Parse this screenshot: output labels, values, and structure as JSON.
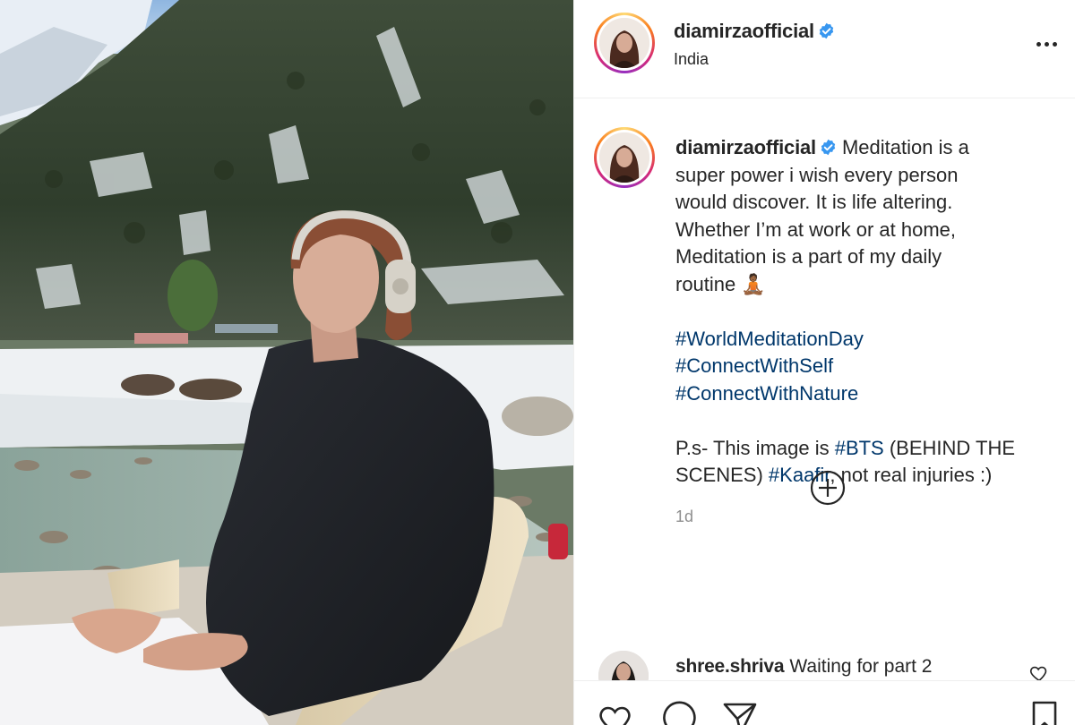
{
  "post": {
    "username": "diamirzaofficial",
    "verified": true,
    "location": "India",
    "more_icon": "more-horizontal-icon"
  },
  "caption": {
    "username": "diamirzaofficial",
    "text_lines": [
      "Meditation is a",
      "super power i wish every person",
      "would discover. It is life altering.",
      "Whether I’m at work or at home,",
      "Meditation is a part of my daily",
      "routine 🧘🏾"
    ],
    "hashtags": [
      "#WorldMeditationDay",
      "#ConnectWithSelf",
      "#ConnectWithNature"
    ],
    "ps": {
      "part1": "P.s- This image is ",
      "tag1": "#BTS",
      "part2": " (BEHIND THE",
      "part3": "SCENES) ",
      "tag2": "#Kaafir",
      "part4": ", not real injuries :)"
    },
    "timestamp": "1d"
  },
  "load_more_icon": "plus-circle-icon",
  "comments": [
    {
      "username": "shree.shriva",
      "text": "Waiting for part 2"
    }
  ],
  "actions": {
    "like_icon": "heart-icon",
    "comment_icon": "comment-icon",
    "share_icon": "paper-plane-icon",
    "save_icon": "bookmark-icon"
  },
  "colors": {
    "text": "#262626",
    "secondary": "#8e8e8e",
    "hashtag": "#00376b",
    "verified": "#3897f0",
    "border": "#efefef"
  }
}
